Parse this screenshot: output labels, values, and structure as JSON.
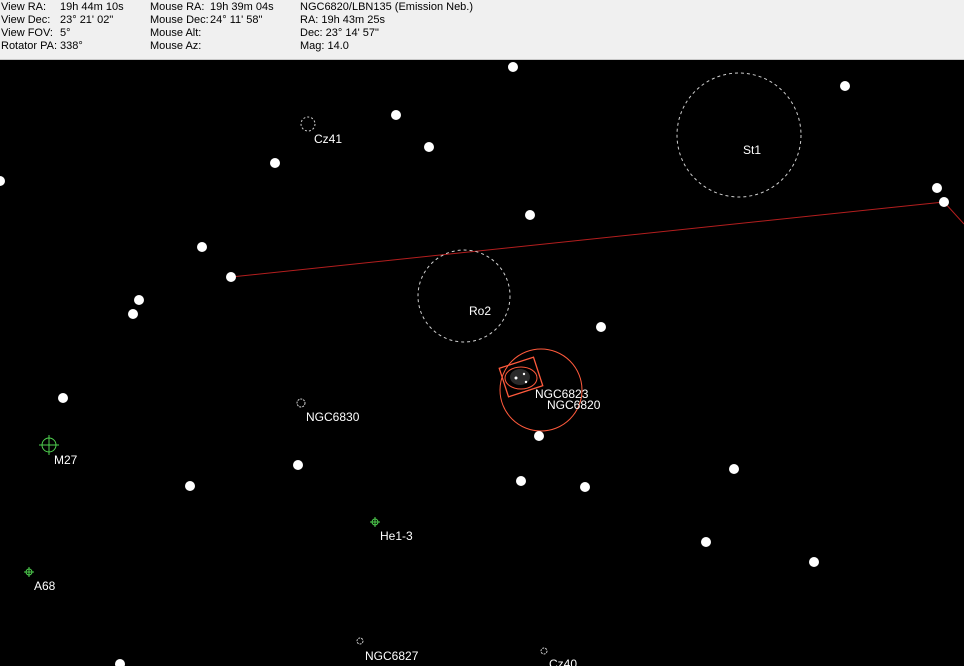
{
  "view": {
    "ra_label": "View RA:",
    "ra_value": "19h 44m 10s",
    "dec_label": "View Dec:",
    "dec_value": "23° 21' 02\"",
    "fov_label": "View FOV:",
    "fov_value": "5°",
    "pa_label": "Rotator PA:",
    "pa_value": "338°"
  },
  "mouse": {
    "ra_label": "Mouse RA:",
    "ra_value": "19h 39m 04s",
    "dec_label": "Mouse Dec:",
    "dec_value": "24° 11' 58\"",
    "alt_label": "Mouse Alt:",
    "alt_value": "",
    "az_label": "Mouse Az:",
    "az_value": ""
  },
  "selected": {
    "name": "NGC6820/LBN135 (Emission Neb.)",
    "ra": "RA: 19h 43m 25s",
    "dec": "Dec: 23° 14' 57\"",
    "mag": "Mag: 14.0"
  },
  "labels": {
    "cz41": "Cz41",
    "st1": "St1",
    "ro2": "Ro2",
    "ngc6823": "NGC6823",
    "ngc6820": "NGC6820",
    "ngc6830": "NGC6830",
    "m27": "M27",
    "he1_3": "He1-3",
    "a68": "A68",
    "ngc6827": "NGC6827",
    "cz40": "Cz40"
  },
  "colors": {
    "background": "#000000",
    "star": "#ffffff",
    "label": "#ffffff",
    "constellation_line": "#b31e1e",
    "selected_marker": "#ff5a3c",
    "planetary_nebula": "#4fd14f",
    "cluster_outline": "#cfcfcf",
    "panel": "#f0f0f0"
  }
}
